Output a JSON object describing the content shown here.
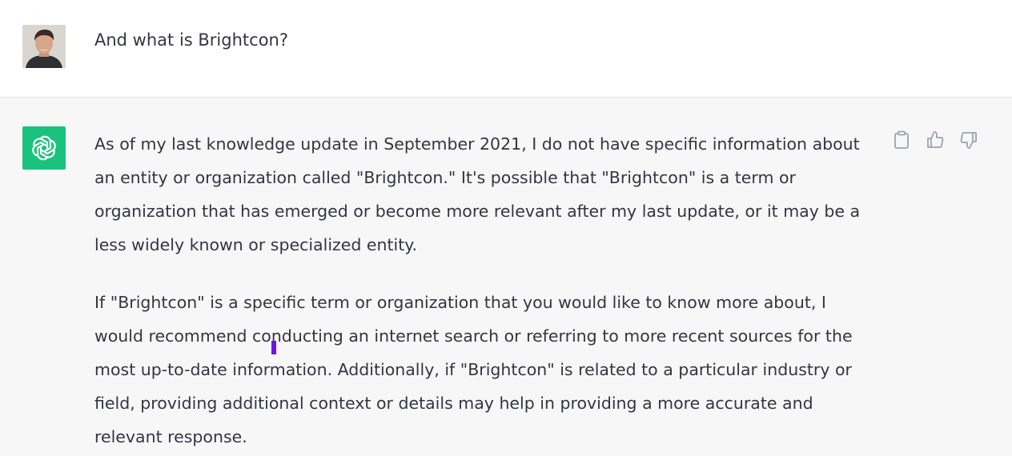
{
  "user_message": {
    "text": "And what is Brightcon?"
  },
  "assistant_message": {
    "paragraphs": [
      "As of my last knowledge update in September 2021, I do not have specific information about an entity or organization called \"Brightcon.\" It's possible that \"Brightcon\" is a term or organization that has emerged or become more relevant after my last update, or it may be a less widely known or specialized entity.",
      "If \"Brightcon\" is a specific term or organization that you would like to know more about, I would recommend conducting an internet search or referring to more recent sources for the most up-to-date information. Additionally, if \"Brightcon\" is related to a particular industry or field, providing additional context or details may help in providing a more accurate and relevant response."
    ],
    "actions": [
      "copy-icon",
      "thumbs-up-icon",
      "thumbs-down-icon"
    ]
  },
  "colors": {
    "logo_bg": "#19c37d",
    "assistant_bg": "#f7f7f8",
    "text": "#343541",
    "caret": "#7014ec"
  }
}
